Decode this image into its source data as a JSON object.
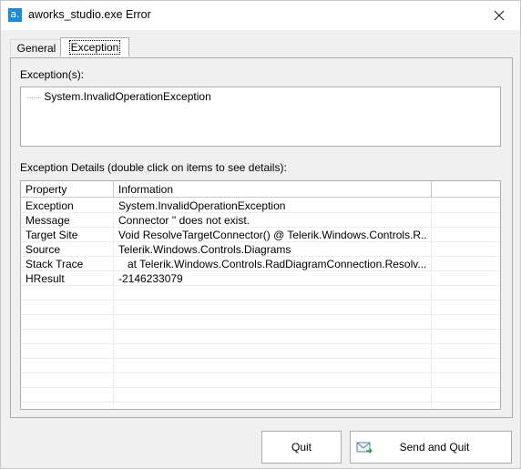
{
  "window": {
    "title": "aworks_studio.exe Error",
    "icon_glyph": "a."
  },
  "tabs": [
    {
      "label": "General"
    },
    {
      "label": "Exception"
    }
  ],
  "exceptions": {
    "label": "Exception(s):",
    "items": [
      "System.InvalidOperationException"
    ]
  },
  "details": {
    "label": "Exception Details (double click on items to see details):",
    "columns": [
      "Property",
      "Information"
    ],
    "rows": [
      {
        "property": "Exception",
        "information": "System.InvalidOperationException"
      },
      {
        "property": "Message",
        "information": "Connector '' does not exist."
      },
      {
        "property": "Target Site",
        "information": "Void ResolveTargetConnector() @ Telerik.Windows.Controls.R..."
      },
      {
        "property": "Source",
        "information": "Telerik.Windows.Controls.Diagrams"
      },
      {
        "property": "Stack Trace",
        "information": "   at Telerik.Windows.Controls.RadDiagramConnection.Resolv..."
      },
      {
        "property": "HResult",
        "information": "-2146233079"
      }
    ]
  },
  "buttons": {
    "quit": "Quit",
    "send_and_quit": "Send and Quit"
  }
}
